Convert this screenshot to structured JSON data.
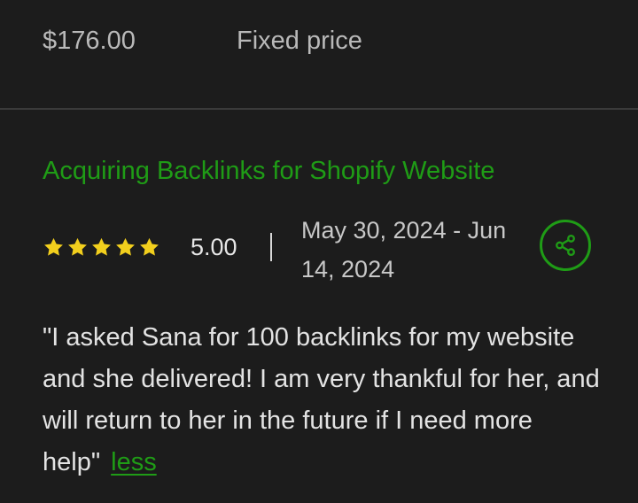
{
  "contract": {
    "price": "$176.00",
    "price_type": "Fixed price"
  },
  "job": {
    "title": "Acquiring Backlinks for Shopify Website",
    "rating": "5.00",
    "stars": 5,
    "date_range": "May 30, 2024 - Jun 14, 2024",
    "feedback": "\"I asked Sana for 100 backlinks for my website and she delivered! I am very thankful for her, and will return to her in the future if I need more help\"",
    "less_label": "less"
  },
  "icons": {
    "star": "star-icon",
    "share": "share-icon"
  },
  "colors": {
    "accent_green": "#1f9c16",
    "star_yellow": "#f2cf1d",
    "background": "#1c1c1c"
  }
}
